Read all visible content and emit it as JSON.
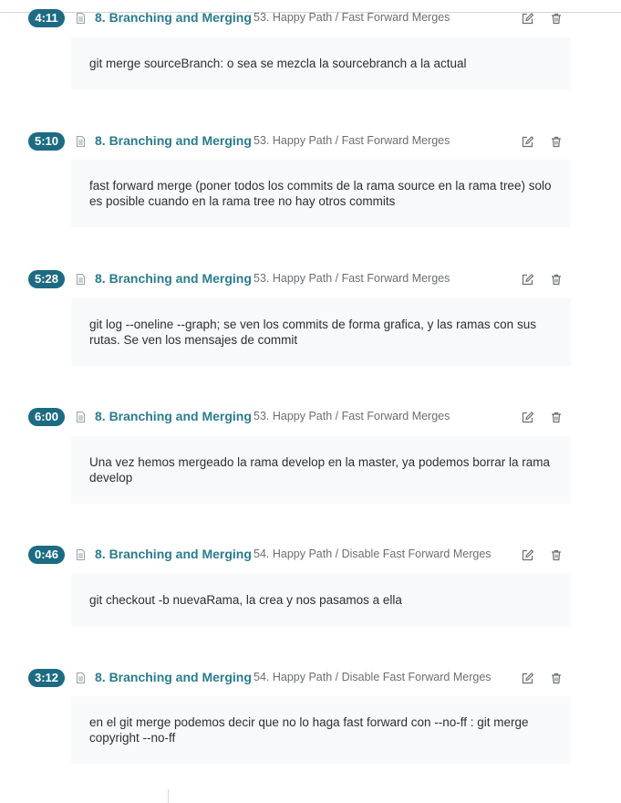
{
  "notes": [
    {
      "time": "4:11",
      "section": "8. Branching and Merging",
      "lecture": "53. Happy Path / Fast Forward Merges",
      "text": "git merge sourceBranch: o sea se mezcla la sourcebranch a la actual"
    },
    {
      "time": "5:10",
      "section": "8. Branching and Merging",
      "lecture": "53. Happy Path / Fast Forward Merges",
      "text": "fast forward merge (poner todos los commits de la rama source en la rama tree) solo es posible cuando en la rama tree no hay otros commits"
    },
    {
      "time": "5:28",
      "section": "8. Branching and Merging",
      "lecture": "53. Happy Path / Fast Forward Merges",
      "text": "git log --oneline --graph; se ven los commits de forma grafica, y las ramas con sus rutas. Se ven los mensajes de commit"
    },
    {
      "time": "6:00",
      "section": "8. Branching and Merging",
      "lecture": "53. Happy Path / Fast Forward Merges",
      "text": "Una vez hemos mergeado la rama develop en la master, ya podemos borrar la rama develop"
    },
    {
      "time": "0:46",
      "section": "8. Branching and Merging",
      "lecture": "54. Happy Path / Disable Fast Forward Merges",
      "text": "git checkout -b nuevaRama, la crea y nos pasamos a ella"
    },
    {
      "time": "3:12",
      "section": "8. Branching and Merging",
      "lecture": "54. Happy Path / Disable Fast Forward Merges",
      "text": "en el git merge podemos decir que no lo haga fast forward con --no-ff : git merge copyright --no-ff"
    }
  ],
  "icons": {
    "lecture": "document-icon",
    "edit": "edit-icon",
    "delete": "trash-icon"
  },
  "colors": {
    "timestamp_bg": "#1c6b82",
    "section_text": "#2a7c8f",
    "note_bg": "#f7f9fa"
  }
}
